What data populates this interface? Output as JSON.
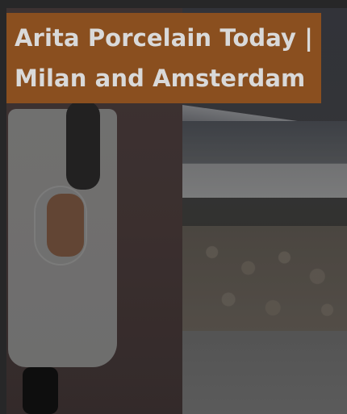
{
  "card": {
    "title": "Arita Porcelain Today | Milan and Amsterdam"
  },
  "colors": {
    "title_background": "#8a4f1f",
    "title_text": "#d9d9d9",
    "overlay": "rgba(0,0,0,0.32)"
  }
}
